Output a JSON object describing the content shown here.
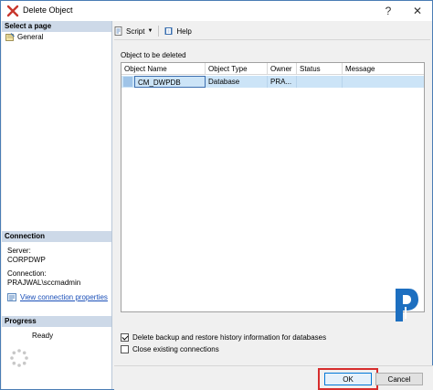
{
  "window": {
    "title": "Delete Object",
    "help_button": "?",
    "close_button": "✕"
  },
  "left_pane": {
    "select_page_header": "Select a page",
    "pages": [
      {
        "label": "General"
      }
    ],
    "connection_header": "Connection",
    "server_label": "Server:",
    "server_value": "CORPDWP",
    "connection_label": "Connection:",
    "connection_value": "PRAJWAL\\sccmadmin",
    "view_connection_link": "View connection properties",
    "progress_header": "Progress",
    "progress_status": "Ready"
  },
  "toolbar": {
    "script_label": "Script",
    "help_label": "Help"
  },
  "content": {
    "objects_label": "Object to be deleted",
    "columns": [
      "Object Name",
      "Object Type",
      "Owner",
      "Status",
      "Message"
    ],
    "rows": [
      {
        "name": "CM_DWPDB",
        "type": "Database",
        "owner": "PRA...",
        "status": "",
        "message": ""
      }
    ],
    "delete_backup_label": "Delete backup and restore history information for databases",
    "delete_backup_checked": true,
    "close_connections_label": "Close existing connections",
    "close_connections_checked": false
  },
  "buttons": {
    "ok_label": "OK",
    "cancel_label": "Cancel"
  },
  "colors": {
    "header_bg": "#cdd9e8",
    "selection_bg": "#cce4f7",
    "highlight_border": "#d62d2d",
    "logo_blue": "#1d6fc0"
  }
}
